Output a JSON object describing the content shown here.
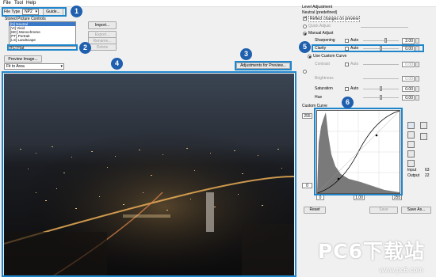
{
  "menu": {
    "file": "File",
    "tool": "Tool",
    "help": "Help"
  },
  "file_type": {
    "label": "File Type",
    "value": "NP2",
    "guide_button": "Guide..."
  },
  "stored_controls": {
    "group_label": "Stored Picture Controls",
    "items": [
      "[N] Neutral",
      "[VI] Vivid",
      "[MC] Monochrome",
      "[PT] Portrait",
      "[LS] Landscape"
    ],
    "selected_index": 0,
    "flat_value": "[FL] Flat",
    "buttons": {
      "import": "Import...",
      "export": "Export...",
      "rename": "Rename...",
      "delete": "Delete"
    }
  },
  "preview": {
    "preview_image_button": "Preview Image...",
    "fit_value": "Fit to Area",
    "adjustments_button": "Adjustments for Preview..."
  },
  "markers": [
    "1",
    "2",
    "3",
    "4",
    "5",
    "6"
  ],
  "level_adjustment": {
    "title": "Level Adjustment",
    "subtitle": "Neutral (predefined)",
    "reflect_label": "Reflect changes on preview",
    "quick_adjust": "Quick Adjust",
    "manual_adjust": "Manual Adjust",
    "sharpening": {
      "label": "Sharpening",
      "auto": "Auto",
      "value": "2.00"
    },
    "clarity": {
      "label": "Clarity",
      "auto": "Auto",
      "value": "0.00"
    },
    "use_custom_curve": "Use Custom Curve",
    "contrast": {
      "label": "Contrast",
      "auto": "Auto",
      "value": "0.00"
    },
    "brightness": {
      "label": "Brightness",
      "value": "0.00"
    },
    "saturation": {
      "label": "Saturation",
      "auto": "Auto",
      "value": "0.00"
    },
    "hue": {
      "label": "Hue",
      "value": "0.00"
    }
  },
  "custom_curve": {
    "title": "Custom Curve",
    "top_value": "255",
    "left_value": "0",
    "bottom_left": "0",
    "bottom_mid": "1.00",
    "bottom_right": "255",
    "input_label": "Input",
    "input_value": "63",
    "output_label": "Output",
    "output_value": "22"
  },
  "footer": {
    "reset": "Reset",
    "save": "Save",
    "save_as": "Save As..."
  },
  "watermark": {
    "main": "PC6下载站",
    "url": "www.pc6.com"
  },
  "colors": {
    "marker": "#1f5fae",
    "highlight": "#1f86cc",
    "selection": "#3a78c8"
  }
}
